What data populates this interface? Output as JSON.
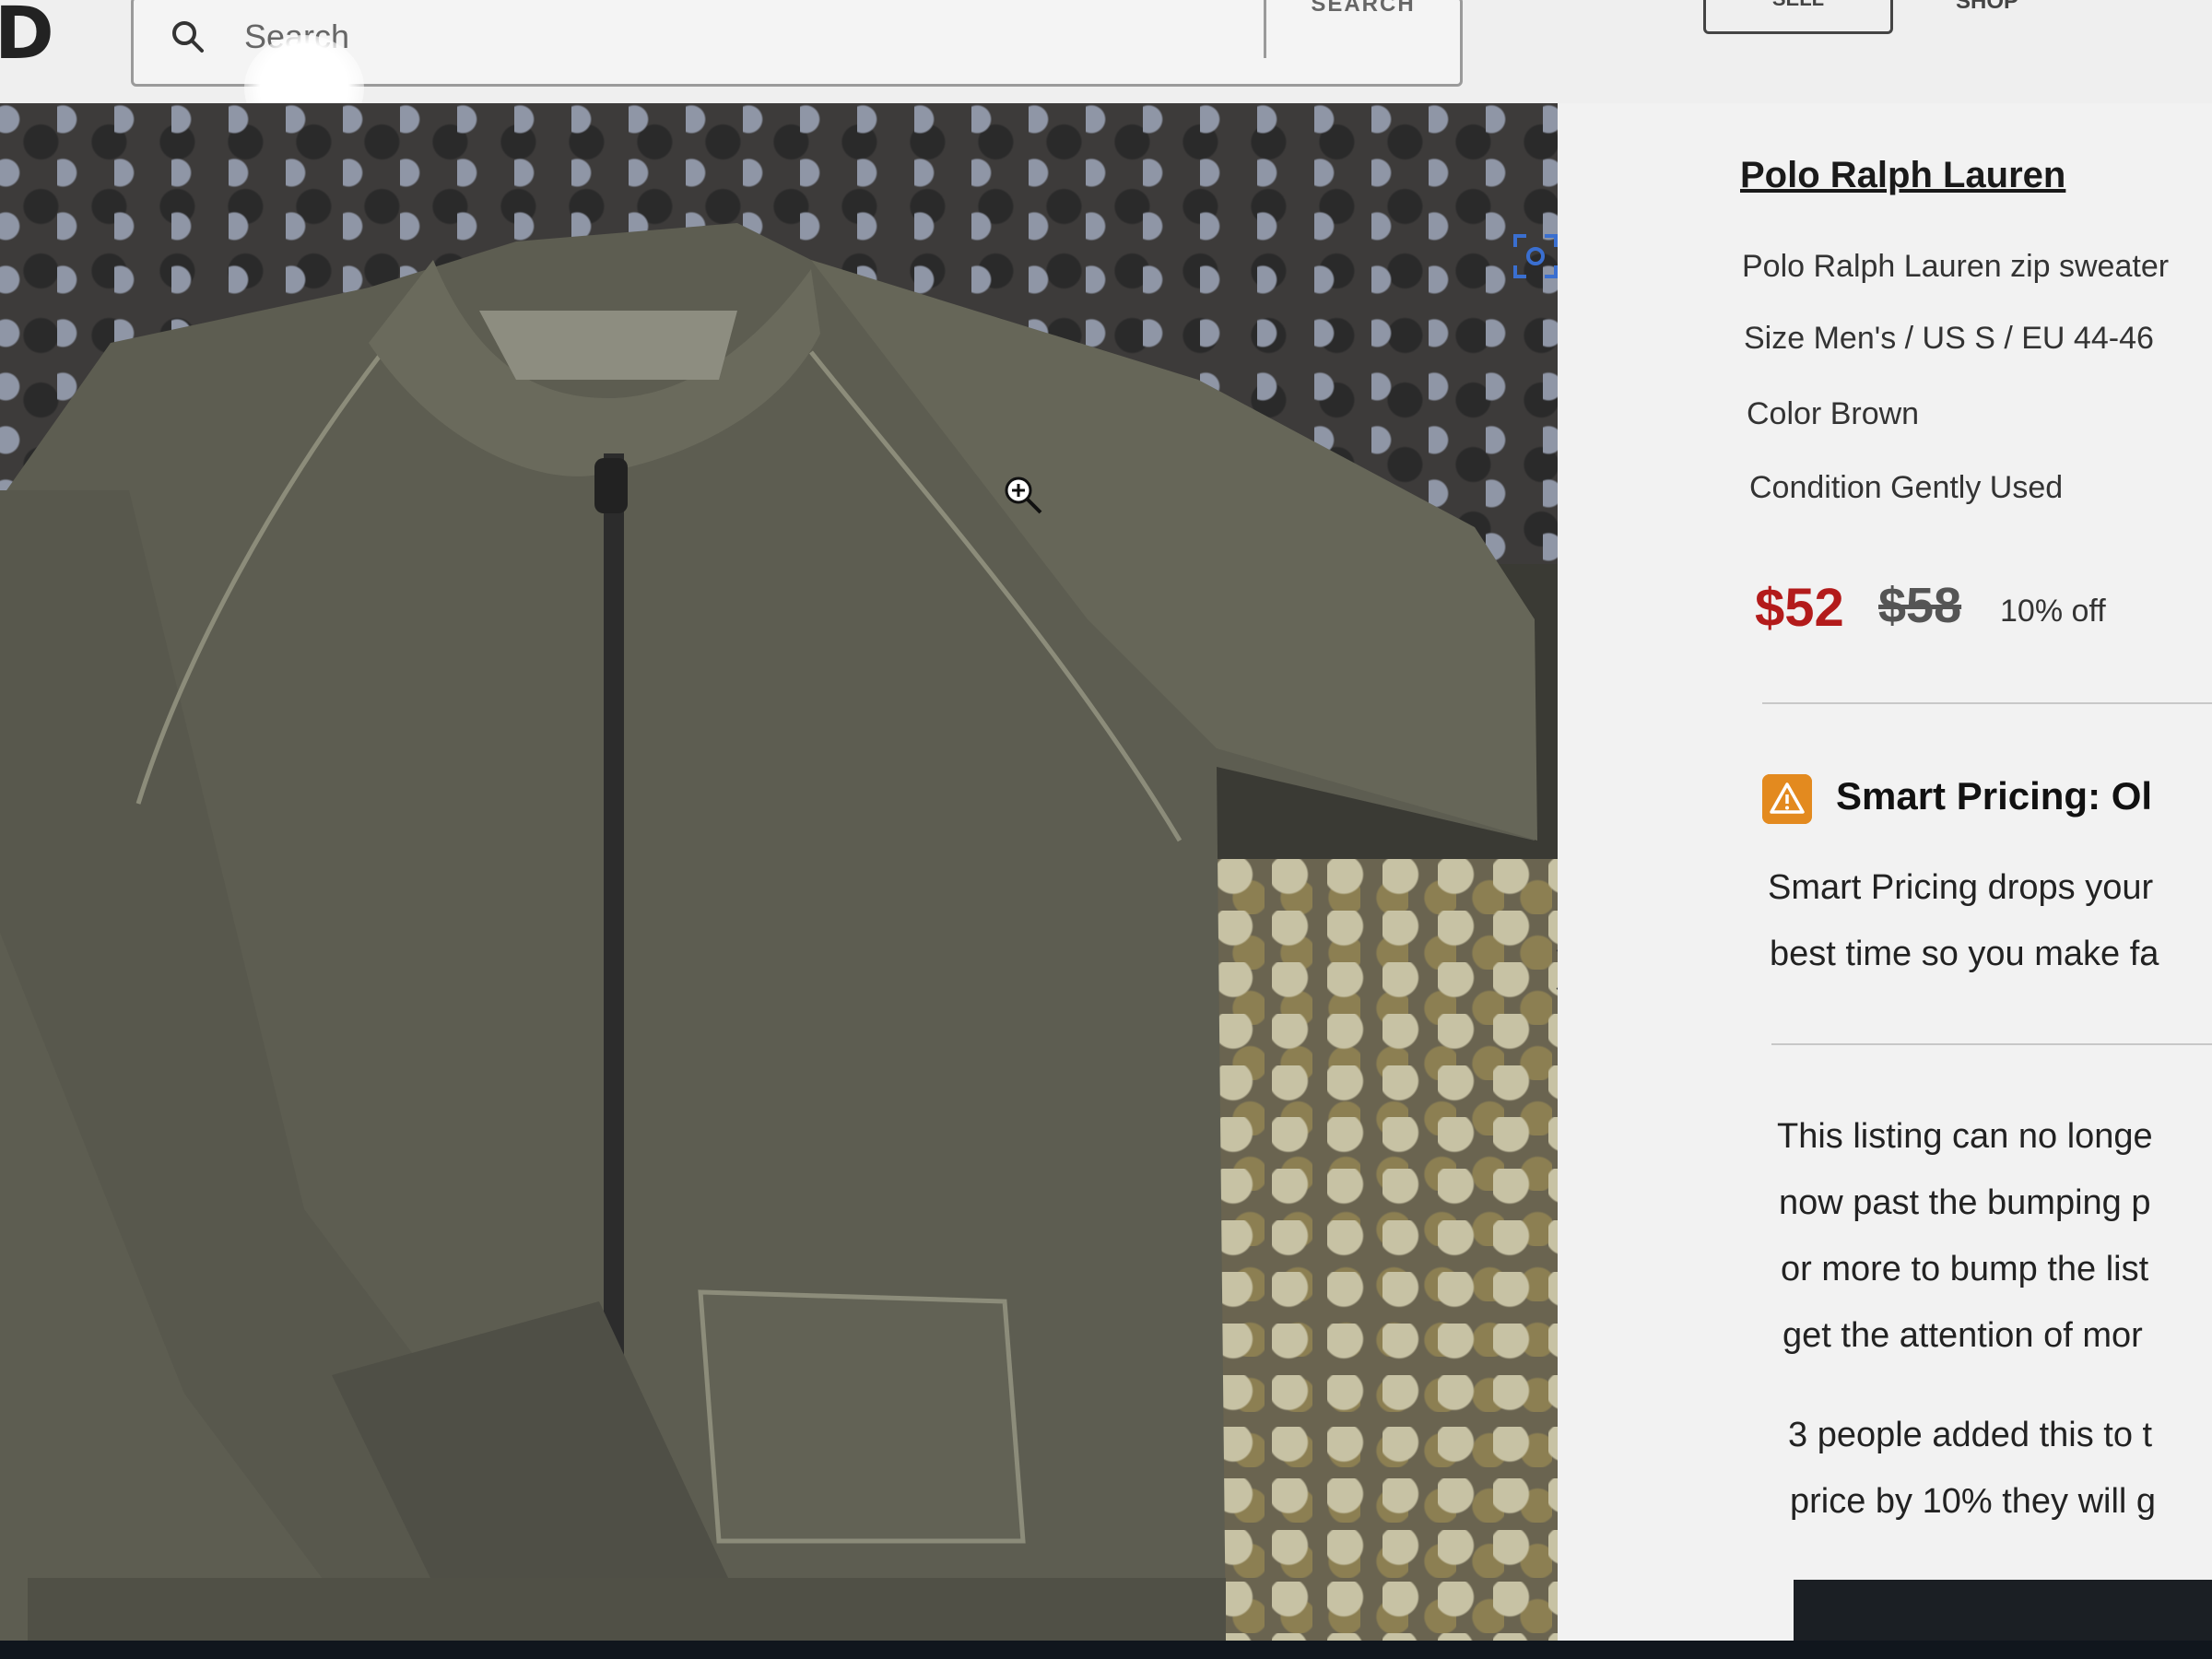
{
  "header": {
    "logo": "D",
    "search": {
      "placeholder": "Search",
      "button_label": "SEARCH"
    },
    "sell_label": "SELL",
    "shop_label": "SHOP"
  },
  "listing": {
    "brand": "Polo Ralph Lauren",
    "title": "Polo Ralph Lauren zip sweater",
    "size": "Size Men's / US S / EU 44-46",
    "color": "Color Brown",
    "condition": "Condition Gently Used",
    "price": "$52",
    "original_price": "$58",
    "discount": "10% off"
  },
  "smart_pricing": {
    "title": "Smart Pricing: Ol",
    "text_line1": "Smart Pricing drops your",
    "text_line2": "best time so you make fa"
  },
  "notice": {
    "bump_lines": [
      "This listing can no longe",
      "now past the bumping p",
      "or more to bump the list",
      "get the attention of mor"
    ],
    "people_lines": [
      "3 people added this to t",
      "price by 10% they will g"
    ]
  },
  "colors": {
    "price_red": "#b31b1b",
    "smart_pricing_orange": "#e38a1f",
    "button_dark": "#1b1f24"
  }
}
